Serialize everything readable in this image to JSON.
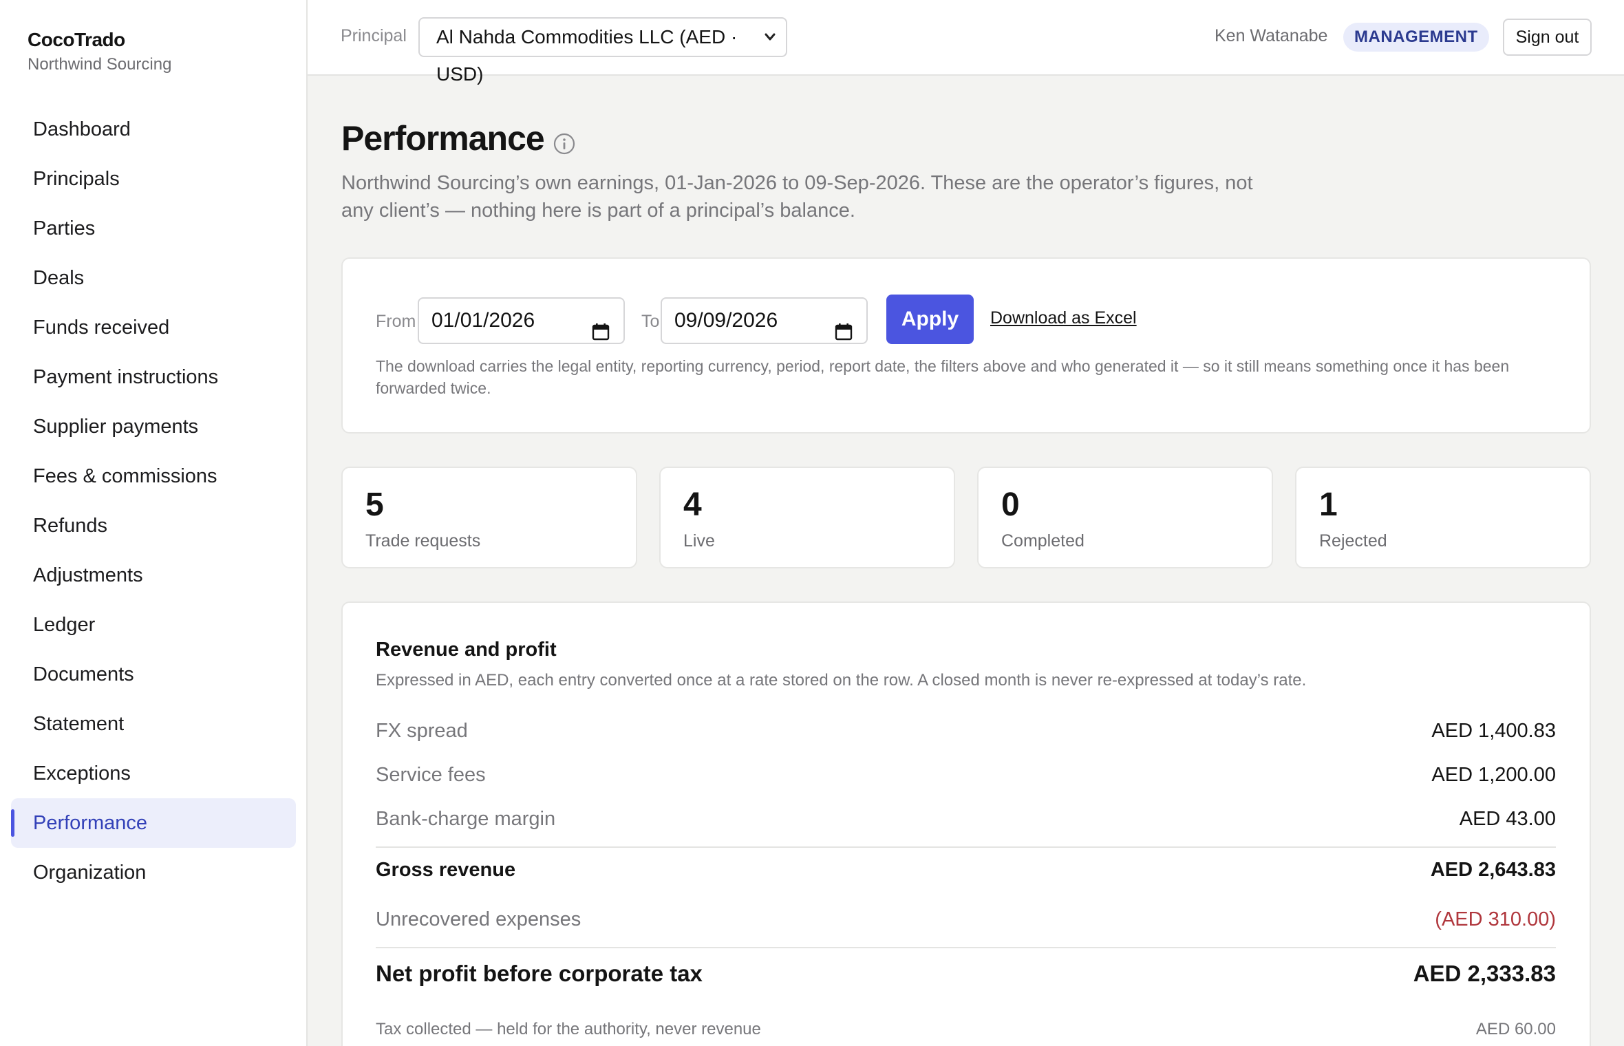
{
  "brand": {
    "name": "CocoTrado",
    "org": "Northwind Sourcing"
  },
  "nav": [
    {
      "label": "Dashboard",
      "active": false
    },
    {
      "label": "Principals",
      "active": false
    },
    {
      "label": "Parties",
      "active": false
    },
    {
      "label": "Deals",
      "active": false
    },
    {
      "label": "Funds received",
      "active": false
    },
    {
      "label": "Payment instructions",
      "active": false
    },
    {
      "label": "Supplier payments",
      "active": false
    },
    {
      "label": "Fees & commissions",
      "active": false
    },
    {
      "label": "Refunds",
      "active": false
    },
    {
      "label": "Adjustments",
      "active": false
    },
    {
      "label": "Ledger",
      "active": false
    },
    {
      "label": "Documents",
      "active": false
    },
    {
      "label": "Statement",
      "active": false
    },
    {
      "label": "Exceptions",
      "active": false
    },
    {
      "label": "Performance",
      "active": true
    },
    {
      "label": "Organization",
      "active": false
    }
  ],
  "topbar": {
    "principal_label": "Principal",
    "principal_value": "Al Nahda Commodities LLC (AED · USD)",
    "user_name": "Ken Watanabe",
    "role": "MANAGEMENT",
    "signout_label": "Sign out"
  },
  "page": {
    "title": "Performance",
    "subtitle": "Northwind Sourcing’s own earnings, 01-Jan-2026 to 09-Sep-2026. These are the operator’s figures, not any client’s — nothing here is part of a principal’s balance."
  },
  "filters": {
    "from_label": "From",
    "from_value": "01/01/2026",
    "to_label": "To",
    "to_value": "09/09/2026",
    "apply_label": "Apply",
    "download_label": "Download as Excel",
    "note": "The download carries the legal entity, reporting currency, period, report date, the filters above and who generated it — so it still means something once it has been forwarded twice."
  },
  "stats": [
    {
      "value": "5",
      "label": "Trade requests"
    },
    {
      "value": "4",
      "label": "Live"
    },
    {
      "value": "0",
      "label": "Completed"
    },
    {
      "value": "1",
      "label": "Rejected"
    }
  ],
  "revenue": {
    "title": "Revenue and profit",
    "subtitle": "Expressed in AED, each entry converted once at a rate stored on the row. A closed month is never re-expressed at today’s rate.",
    "fx_spread": {
      "label": "FX spread",
      "value": "AED 1,400.83"
    },
    "service_fees": {
      "label": "Service fees",
      "value": "AED 1,200.00"
    },
    "bank_margin": {
      "label": "Bank-charge margin",
      "value": "AED 43.00"
    },
    "gross": {
      "label": "Gross revenue",
      "value": "AED 2,643.83"
    },
    "unrecovered": {
      "label": "Unrecovered expenses",
      "value": "(AED 310.00)"
    },
    "net": {
      "label": "Net profit before corporate tax",
      "value": "AED 2,333.83"
    },
    "tax": {
      "label": "Tax collected — held for the authority, never revenue",
      "value": "AED 60.00"
    }
  },
  "colors": {
    "accent": "#4b55e0",
    "negative": "#b0373d",
    "active_nav_bg": "#eceefb"
  }
}
